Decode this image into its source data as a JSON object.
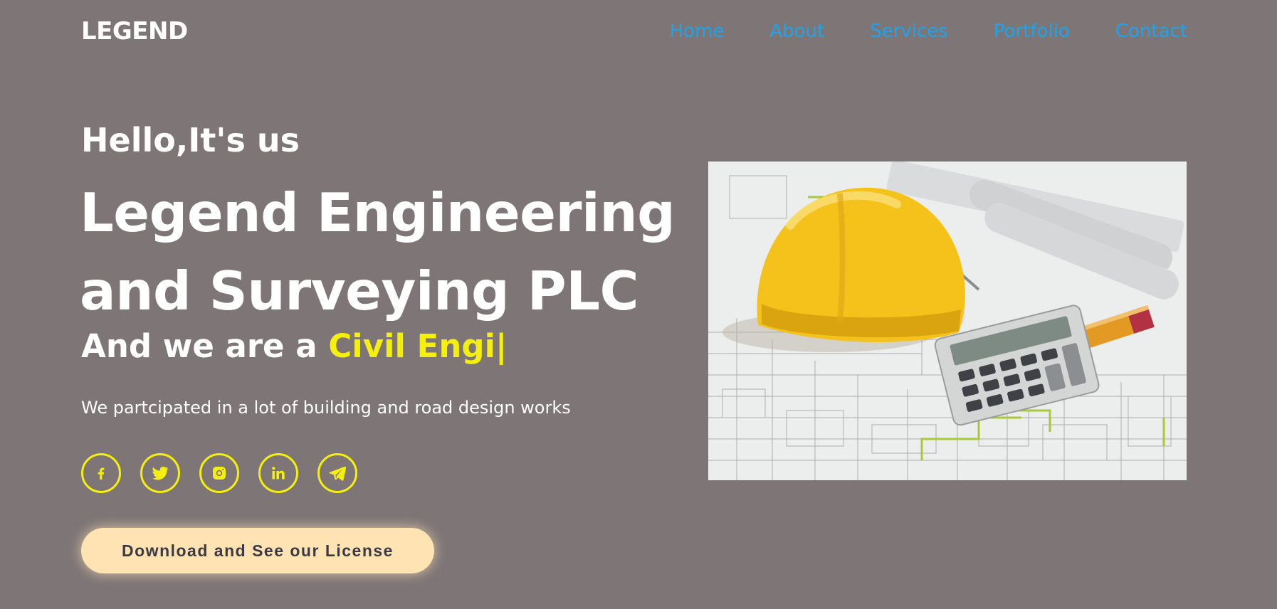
{
  "header": {
    "logo": "LEGEND",
    "nav": [
      "Home",
      "About",
      "Services",
      "Portfolio",
      "Contact"
    ]
  },
  "hero": {
    "greeting": "Hello,It's us",
    "title_line1": "Legend Engineering",
    "title_line2": "and Surveying PLC",
    "typed_prefix": "And we are a ",
    "typed_text": "Civil Engi",
    "cursor": "|",
    "tagline": "We partcipated in a lot of building and road design works",
    "cta_label": "Download and See our License",
    "image_icon": "hard-hat-blueprints-calculator-image"
  },
  "socials": [
    {
      "icon": "facebook-icon"
    },
    {
      "icon": "twitter-icon"
    },
    {
      "icon": "instagram-icon"
    },
    {
      "icon": "linkedin-icon"
    },
    {
      "icon": "telegram-icon"
    }
  ],
  "colors": {
    "background": "#7d7576",
    "nav_link": "#1ea4ea",
    "accent_yellow": "#f5ef0e",
    "button_bg": "#ffe3b3",
    "button_text": "#3a3a44"
  }
}
